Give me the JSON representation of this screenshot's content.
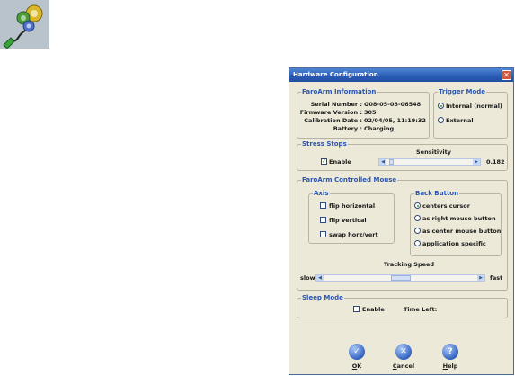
{
  "dialog": {
    "title": "Hardware Configuration",
    "close_glyph": "✕"
  },
  "faroarm_info": {
    "title": "FaroArm Information",
    "rows": [
      {
        "label": "Serial Number :",
        "value": "G08-05-08-06548"
      },
      {
        "label": "Firmware Version :",
        "value": "305"
      },
      {
        "label": "Calibration Date :",
        "value": "02/04/05, 11:19:32"
      },
      {
        "label": "Battery :",
        "value": "Charging"
      }
    ]
  },
  "trigger_mode": {
    "title": "Trigger Mode",
    "options": [
      {
        "label": "Internal (normal)",
        "selected": true
      },
      {
        "label": "External",
        "selected": false
      }
    ]
  },
  "stress_stops": {
    "title": "Stress Stops",
    "sensitivity_label": "Sensitivity",
    "enable_label": "Enable",
    "enable_checked": true,
    "value": "0.182",
    "slider_fraction": 0.03
  },
  "controlled_mouse": {
    "title": "FaroArm Controlled Mouse",
    "axis": {
      "title": "Axis",
      "options": [
        {
          "label": "flip horizontal",
          "checked": false
        },
        {
          "label": "flip vertical",
          "checked": false
        },
        {
          "label": "swap horz/vert",
          "checked": false
        }
      ]
    },
    "back_button": {
      "title": "Back Button",
      "options": [
        {
          "label": "centers cursor",
          "selected": true
        },
        {
          "label": "as right mouse button",
          "selected": false
        },
        {
          "label": "as center mouse button",
          "selected": false
        },
        {
          "label": "application specific",
          "selected": false
        }
      ]
    },
    "tracking": {
      "title": "Tracking Speed",
      "slow_label": "slow",
      "fast_label": "fast",
      "slider_fraction": 0.5
    }
  },
  "sleep_mode": {
    "title": "Sleep Mode",
    "enable_label": "Enable",
    "enable_checked": false,
    "time_left_label": "Time Left:"
  },
  "buttons": {
    "ok": {
      "underline": "O",
      "rest": "K",
      "icon": "✓"
    },
    "cancel": {
      "underline": "C",
      "rest": "ancel",
      "icon": "✕"
    },
    "help": {
      "underline": "H",
      "rest": "elp",
      "icon": "?"
    }
  },
  "colors": {
    "title_bar": "#2a5bb3",
    "group_title": "#2b56b4",
    "window_bg": "#ece9d8"
  },
  "icons": {
    "app_icon": "gears-cable-icon"
  }
}
